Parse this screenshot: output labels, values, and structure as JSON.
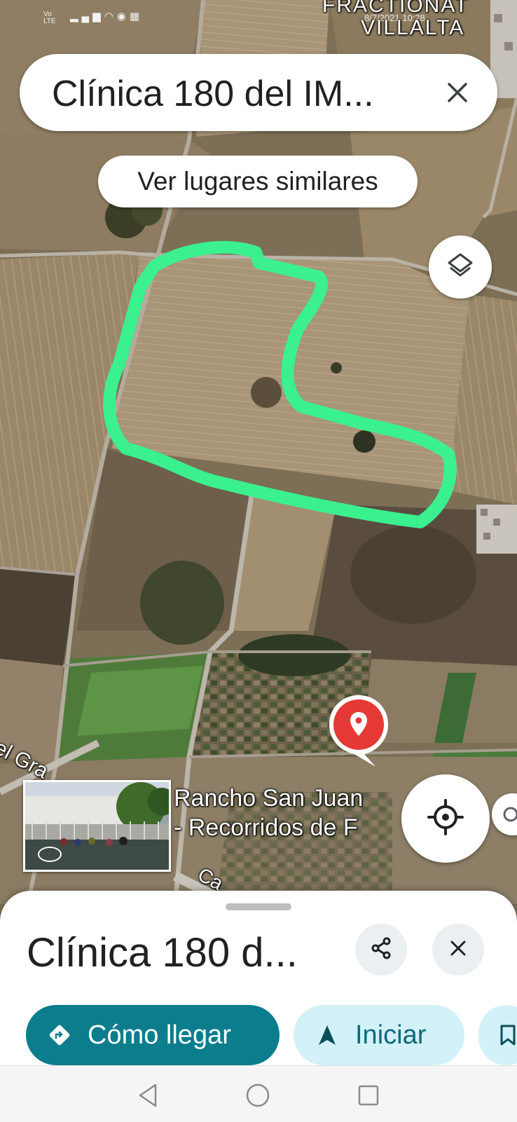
{
  "status": {
    "signal_top": "Vo",
    "signal_bottom": "LTE",
    "clock": "8/7/2021 10:28"
  },
  "map": {
    "label_top_line1": "FRACTIONAT",
    "label_top_line2": "VILLALTA",
    "label_road": "el Gra",
    "label_road2": "Ca",
    "place_label_line1": "Rancho San Juan",
    "place_label_line2": "- Recorridos de F"
  },
  "search": {
    "query": "Clínica 180 del IM..."
  },
  "chip": {
    "label": "Ver lugares similares"
  },
  "sheet": {
    "place_title": "Clínica 180 d...",
    "directions_label": "Cómo llegar",
    "start_label": "Iniciar"
  },
  "colors": {
    "accent_teal": "#0b7d8c",
    "pill_light": "#d3f1f8",
    "pin_red": "#e53935",
    "boundary_green": "#3bf08f"
  },
  "icons": {
    "search_close": "close-icon",
    "layers": "layers-icon",
    "pin": "location-pin-icon",
    "my_location": "my-location-icon",
    "share": "share-icon",
    "sheet_close": "close-icon",
    "directions": "directions-icon",
    "navigation": "navigation-arrow-icon",
    "save": "bookmark-icon",
    "back": "back-triangle-icon",
    "home": "home-circle-icon",
    "recents": "recents-square-icon",
    "street_view": "street-view-360-icon"
  }
}
